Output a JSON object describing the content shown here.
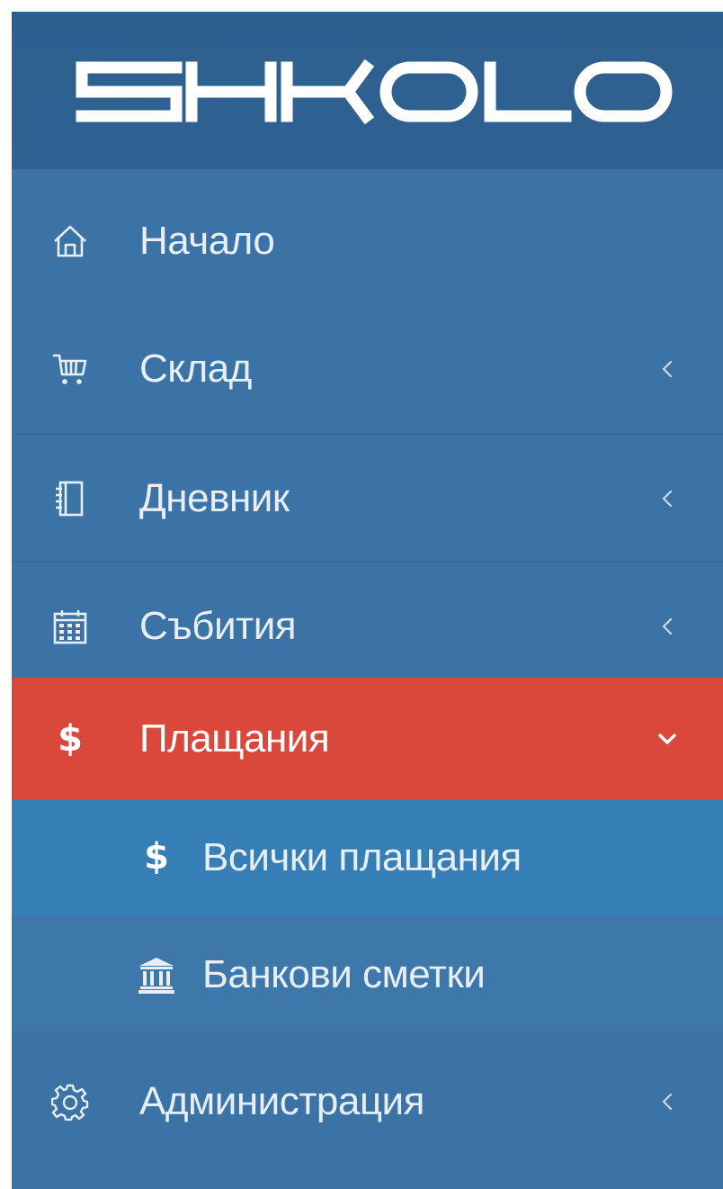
{
  "logo": {
    "text": "SHKOLO"
  },
  "menu": {
    "items": [
      {
        "label": "Начало",
        "icon": "home-icon",
        "has_chevron": false
      },
      {
        "label": "Склад",
        "icon": "cart-icon",
        "has_chevron": true,
        "chevron": "‹"
      },
      {
        "label": "Дневник",
        "icon": "notebook-icon",
        "has_chevron": true,
        "chevron": "‹"
      },
      {
        "label": "Събития",
        "icon": "calendar-icon",
        "has_chevron": true,
        "chevron": "‹"
      },
      {
        "label": "Плащания",
        "icon": "dollar-icon",
        "icon_glyph": "$",
        "has_chevron": true,
        "chevron": "v",
        "active": true
      },
      {
        "label": "Администрация",
        "icon": "gear-icon",
        "has_chevron": true,
        "chevron": "‹"
      }
    ],
    "submenu": [
      {
        "label": "Всички плащания",
        "icon": "dollar-icon",
        "icon_glyph": "$",
        "highlighted": true
      },
      {
        "label": "Банкови сметки",
        "icon": "bank-icon"
      }
    ]
  },
  "colors": {
    "sidebar_bg": "#3c73a6",
    "logo_bg": "#2f6292",
    "active_bg": "#d9483a",
    "submenu_highlight": "#357eb6",
    "text": "#e7eef6"
  }
}
